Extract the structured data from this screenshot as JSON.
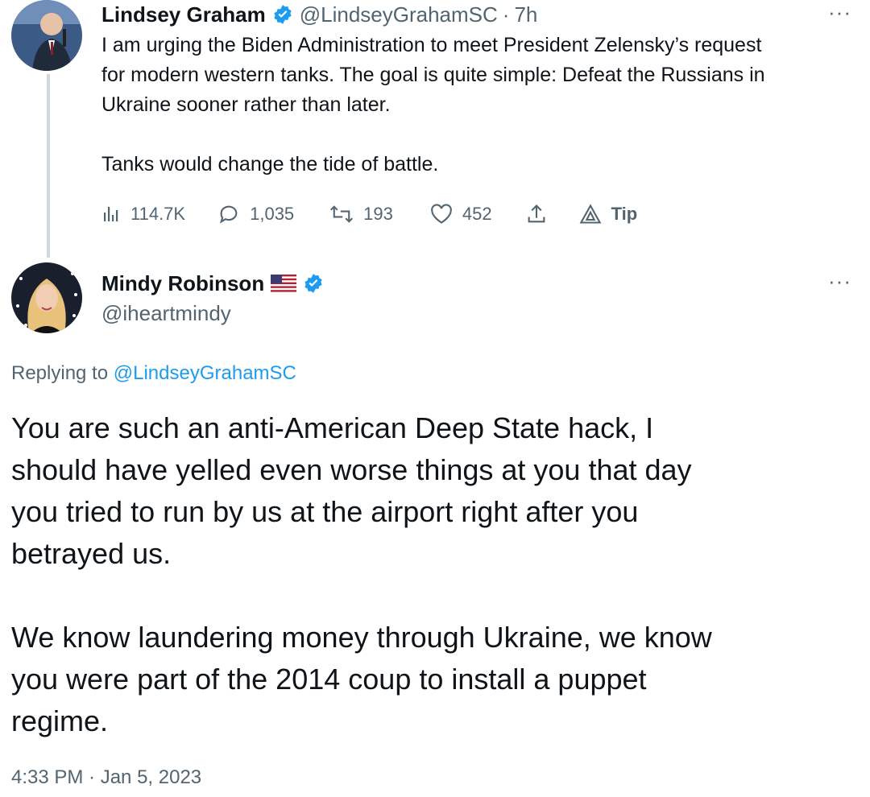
{
  "colors": {
    "verified": "#1d9bf0",
    "secondary_text": "#536471",
    "thread_line": "#cfd9de"
  },
  "tweet1": {
    "author_name": "Lindsey Graham",
    "handle": "@LindseyGrahamSC",
    "separator": "·",
    "time": "7h",
    "more": "···",
    "text_lines": [
      "I am urging the Biden Administration to meet President Zelensky’s request",
      "for modern western tanks. The goal is quite simple: Defeat the Russians in",
      "Ukraine sooner rather than later.",
      "Tanks would change the tide of battle."
    ],
    "views": "114.7K",
    "replies": "1,035",
    "retweets": "193",
    "likes": "452",
    "tip_label": "Tip"
  },
  "tweet2": {
    "author_name": "Mindy Robinson",
    "handle": "@iheartmindy",
    "more": "···",
    "replying_prefix": "Replying to ",
    "replying_handle": "@LindseyGrahamSC",
    "text_lines": [
      "You are such an anti-American Deep State hack, I",
      "should have yelled even worse things at you that day",
      "you tried to run by us at the airport right after you",
      "betrayed us.",
      "We know laundering money through Ukraine, we know",
      "you were part of the 2014 coup to install a puppet",
      "regime."
    ],
    "timestamp": "4:33 PM · Jan 5, 2023"
  }
}
